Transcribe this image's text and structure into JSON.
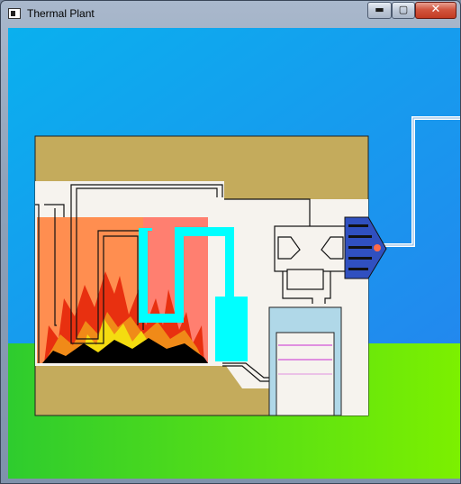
{
  "window": {
    "title": "Thermal Plant",
    "controls": {
      "minimize": "▬",
      "maximize": "▢",
      "close": "✕"
    }
  },
  "icons": [
    "app-icon",
    "minimize-icon",
    "maximize-icon",
    "close-icon"
  ],
  "colors": {
    "sky_top": "#0ab0ee",
    "sky_bottom": "#2288ee",
    "grass_left": "#2ecc2e",
    "grass_right": "#7cf000",
    "building_brown": "#c4ab5c",
    "building_floor": "#f6f3ee",
    "furnace_orange": "#ff8e50",
    "furnace_salmon": "#ff7f70",
    "flame_red": "#e83010",
    "flame_orange": "#f08a18",
    "flame_yellow": "#f4dc10",
    "water_pipe": "#00ffff",
    "condenser": "#b0d8e8",
    "condenser_coils": "#e090e0",
    "generator": "#3050c0",
    "generator_light": "#ff6a4a",
    "power_line": "#ffffff"
  }
}
